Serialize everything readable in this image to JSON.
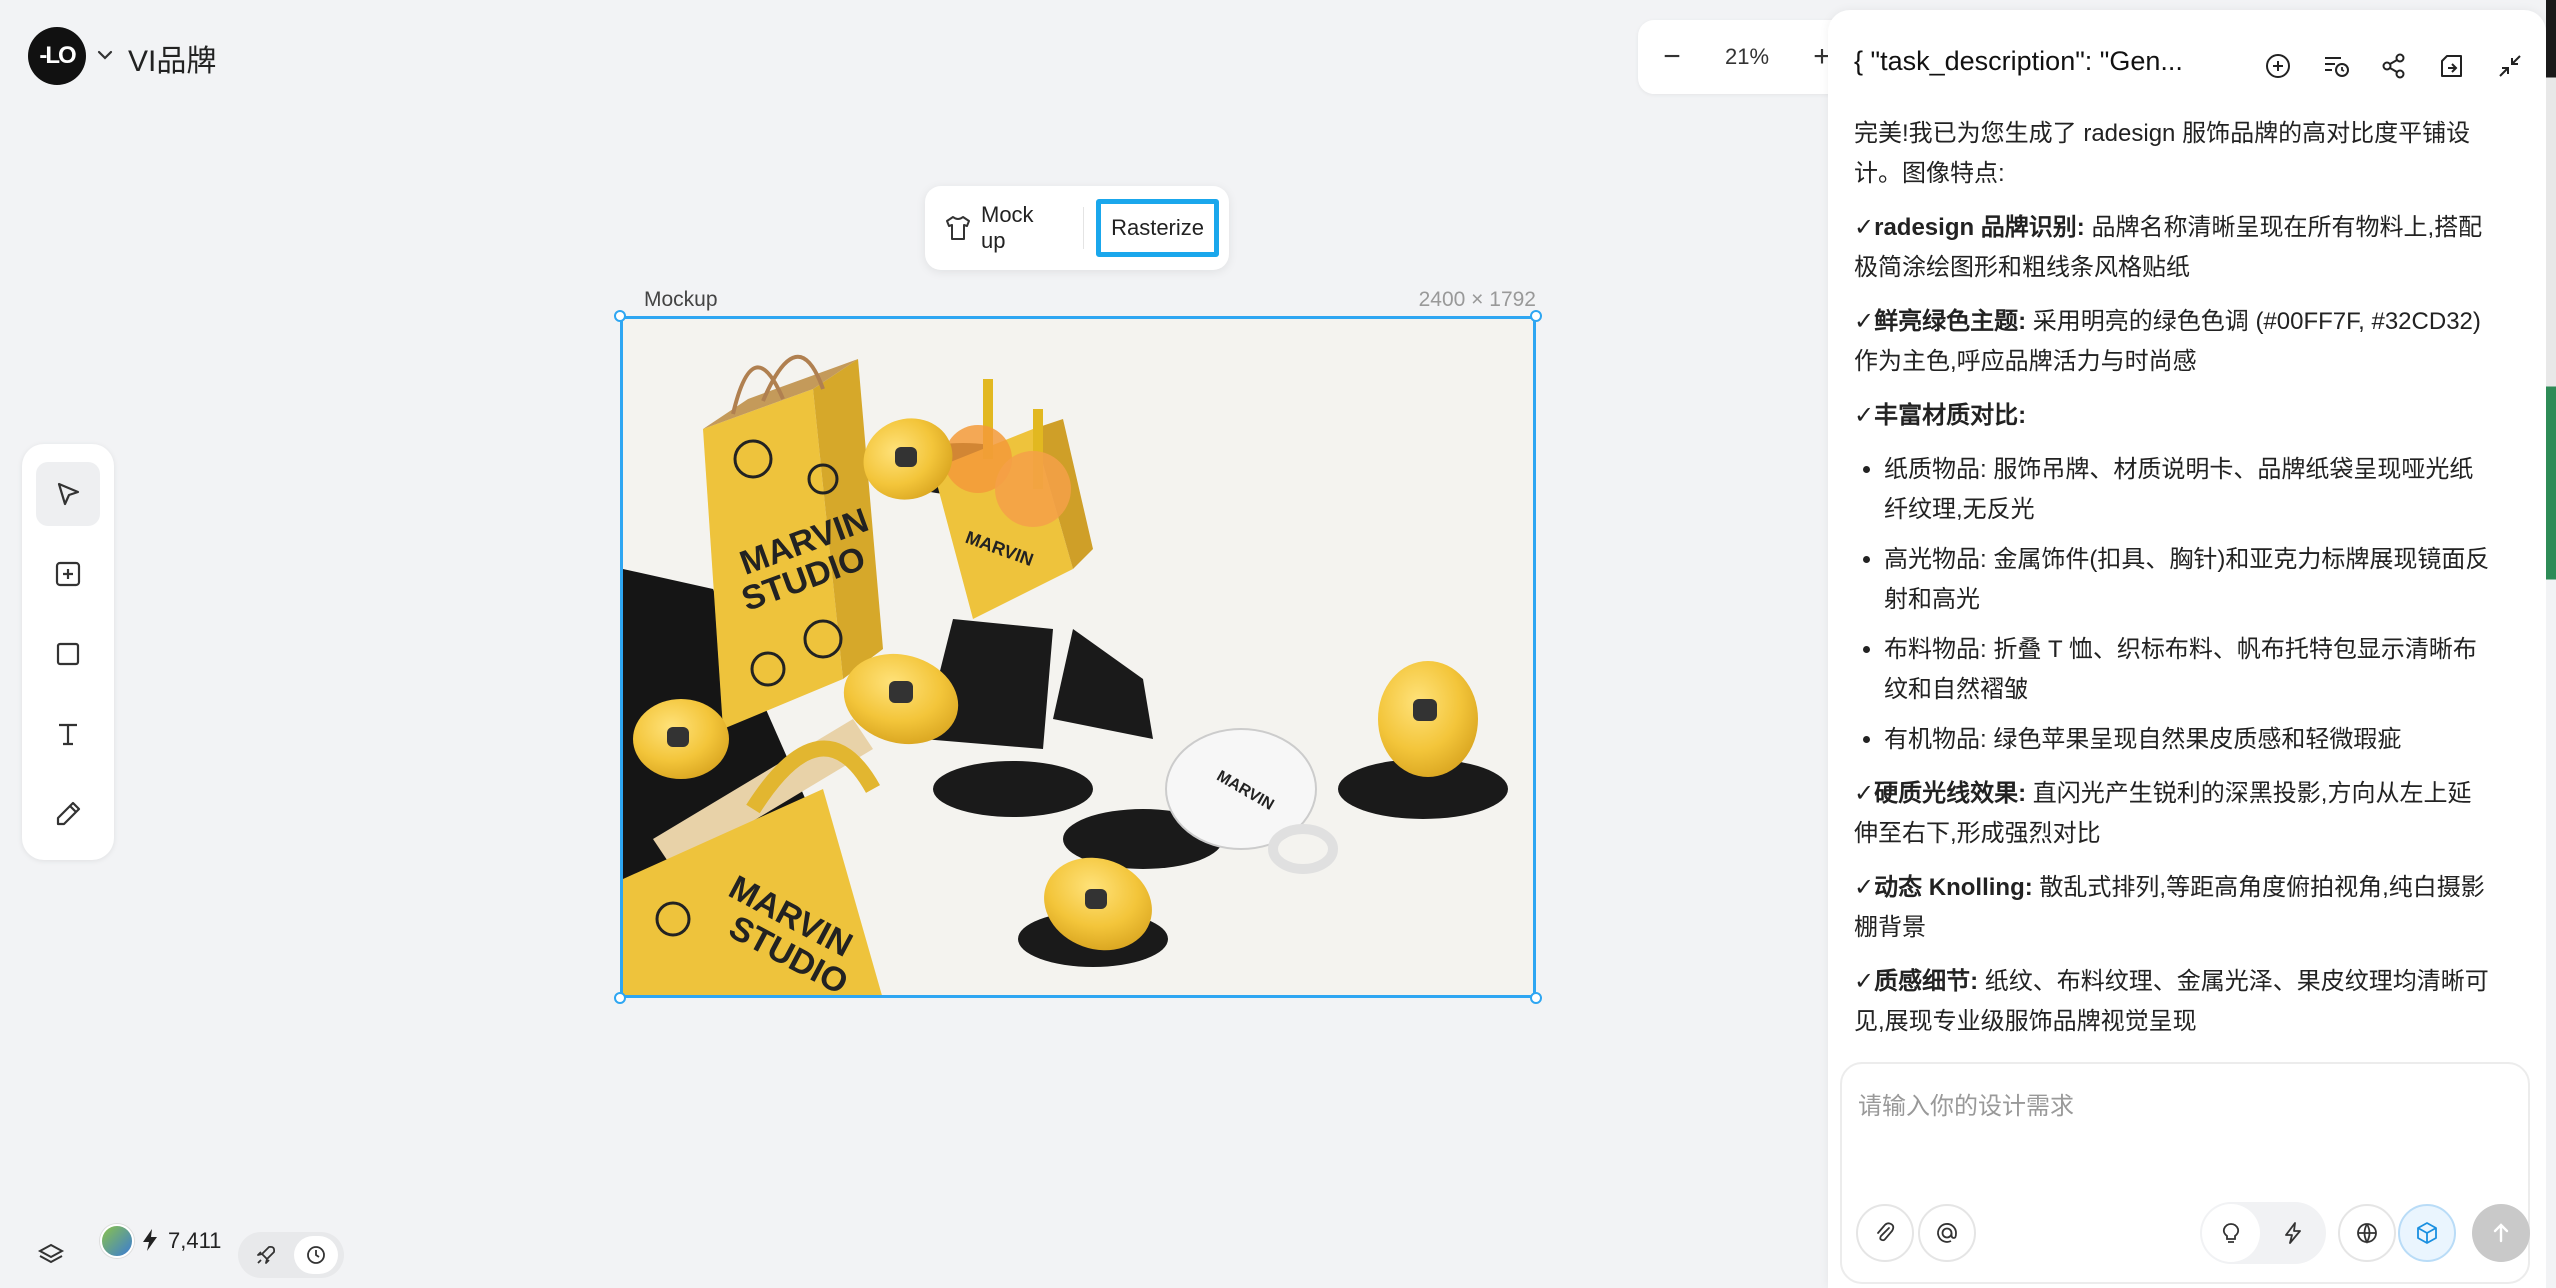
{
  "header": {
    "logo_text": "-LO",
    "project_title": "VI品牌"
  },
  "zoom": {
    "minus": "−",
    "value": "21%",
    "plus": "+"
  },
  "image_toolbar": {
    "mockup_label": "Mock up",
    "rasterize_label": "Rasterize"
  },
  "frame": {
    "label": "Mockup",
    "size": "2400 × 1792"
  },
  "mockup_image": {
    "bag_text": "MARVIN® STUDIO",
    "tote_text": "MARVIN STUDIO",
    "mug_text": "MARVIN STUDIO",
    "brand_color": "#f0c53a"
  },
  "tools": [
    "select-tool",
    "add-frame-tool",
    "rectangle-tool",
    "text-tool",
    "pen-tool"
  ],
  "footer": {
    "credits": "7,411"
  },
  "panel": {
    "title": "{ \"task_description\": \"Gen...",
    "intro": "完美!我已为您生成了 radesign 服饰品牌的高对比度平铺设计。图像特点:",
    "features": [
      {
        "head": "✓radesign 品牌识别:",
        "text": " 品牌名称清晰呈现在所有物料上,搭配极简涂绘图形和粗线条风格贴纸"
      },
      {
        "head": "✓鲜亮绿色主题:",
        "text": " 采用明亮的绿色色调 (#00FF7F, #32CD32) 作为主色,呼应品牌活力与时尚感"
      },
      {
        "head": "✓丰富材质对比:",
        "text": ""
      }
    ],
    "bullets": [
      "纸质物品: 服饰吊牌、材质说明卡、品牌纸袋呈现哑光纸纤纹理,无反光",
      "高光物品: 金属饰件(扣具、胸针)和亚克力标牌展现镜面反射和高光",
      "布料物品: 折叠 T 恤、织标布料、帆布托特包显示清晰布纹和自然褶皱",
      "有机物品: 绿色苹果呈现自然果皮质感和轻微瑕疵"
    ],
    "features2": [
      {
        "head": "✓硬质光线效果:",
        "text": " 直闪光产生锐利的深黑投影,方向从左上延伸至右下,形成强烈对比"
      },
      {
        "head": "✓动态 Knolling:",
        "text": " 散乱式排列,等距高角度俯拍视角,纯白摄影棚背景"
      },
      {
        "head": "✓质感细节:",
        "text": " 纸纹、布料纹理、金属光泽、果皮纹理均清晰可见,展现专业级服饰品牌视觉呈现"
      }
    ],
    "input_placeholder": "请输入你的设计需求"
  },
  "colors": {
    "accent": "#2ea6f2",
    "canvas_bg": "#f2f3f5"
  }
}
